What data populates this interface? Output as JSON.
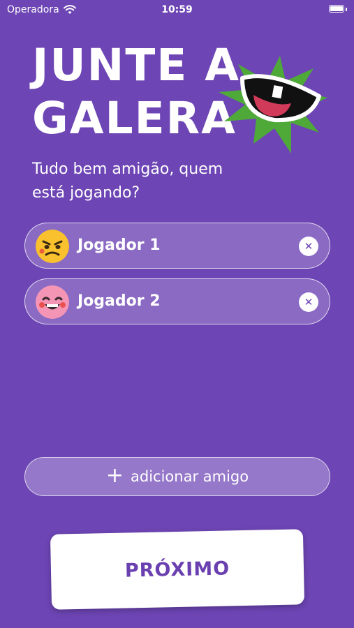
{
  "status_bar": {
    "carrier": "Operadora",
    "time": "10:59"
  },
  "header": {
    "title_line1": "JUNTE A",
    "title_line2": "GALERA",
    "subtitle_line1": "Tudo bem amigão, quem",
    "subtitle_line2": "está jogando?"
  },
  "players": [
    {
      "name": "Jogador 1",
      "avatar_color": "#f9c12e",
      "avatar": "angry-face-icon"
    },
    {
      "name": "Jogador 2",
      "avatar_color": "#f595b6",
      "avatar": "laughing-face-icon"
    }
  ],
  "remove_symbol": "✕",
  "add_friend": {
    "icon": "+",
    "label": "adicionar amigo"
  },
  "next_button": {
    "label": "PRÓXIMO"
  },
  "colors": {
    "background": "#6d45b4",
    "accent_green": "#4ea939",
    "mouth_red": "#d23a5a",
    "button_text": "#6a3fb0"
  }
}
